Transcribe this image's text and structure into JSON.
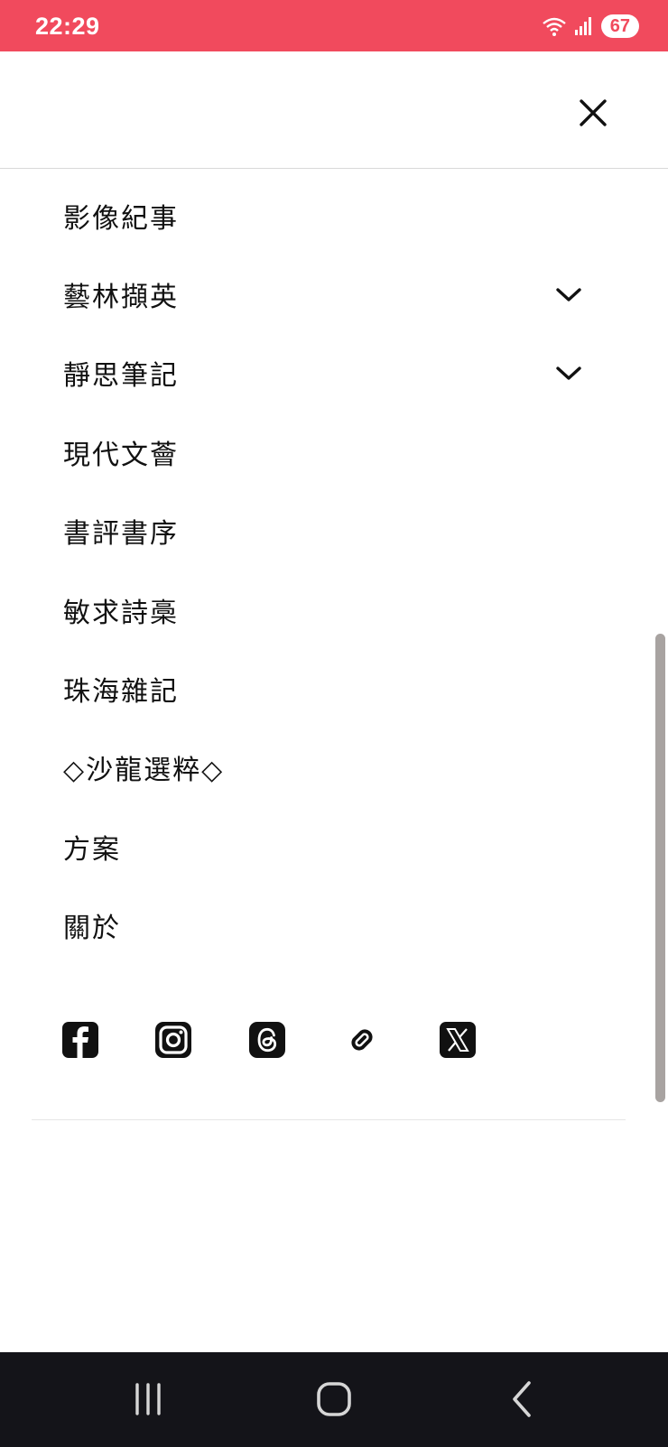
{
  "status": {
    "time": "22:29",
    "battery": "67"
  },
  "header": {
    "close_icon": "close-icon"
  },
  "menu": {
    "items": [
      {
        "label": "影像紀事",
        "expandable": false
      },
      {
        "label": "藝林擷英",
        "expandable": true
      },
      {
        "label": "靜思筆記",
        "expandable": true
      },
      {
        "label": "現代文薈",
        "expandable": false
      },
      {
        "label": "書評書序",
        "expandable": false
      },
      {
        "label": "敏求詩槀",
        "expandable": false
      },
      {
        "label": "珠海雜記",
        "expandable": false
      },
      {
        "label": "◇沙龍選粹◇",
        "expandable": false
      },
      {
        "label": "方案",
        "expandable": false
      },
      {
        "label": "關於",
        "expandable": false
      }
    ]
  },
  "social": [
    "facebook-icon",
    "instagram-icon",
    "threads-icon",
    "link-icon",
    "x-icon"
  ],
  "colors": {
    "status_bar": "#f14a5d",
    "nav_bar": "#141419",
    "text": "#111111"
  }
}
